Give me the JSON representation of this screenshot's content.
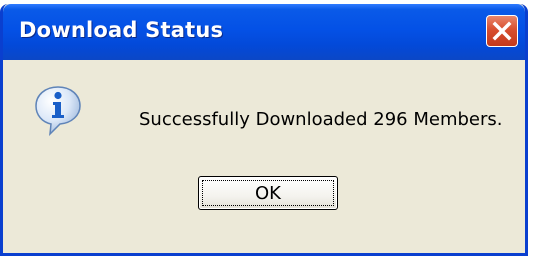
{
  "window": {
    "title": "Download Status",
    "close_icon": "close-icon"
  },
  "content": {
    "icon": "information-icon",
    "message": "Successfully Downloaded 296 Members."
  },
  "buttons": {
    "ok_label": "OK"
  },
  "colors": {
    "titlebar": "#0451e6",
    "close_button": "#d84f2f",
    "dialog_background": "#ece9d8",
    "info_icon": "#1a5fc8"
  }
}
